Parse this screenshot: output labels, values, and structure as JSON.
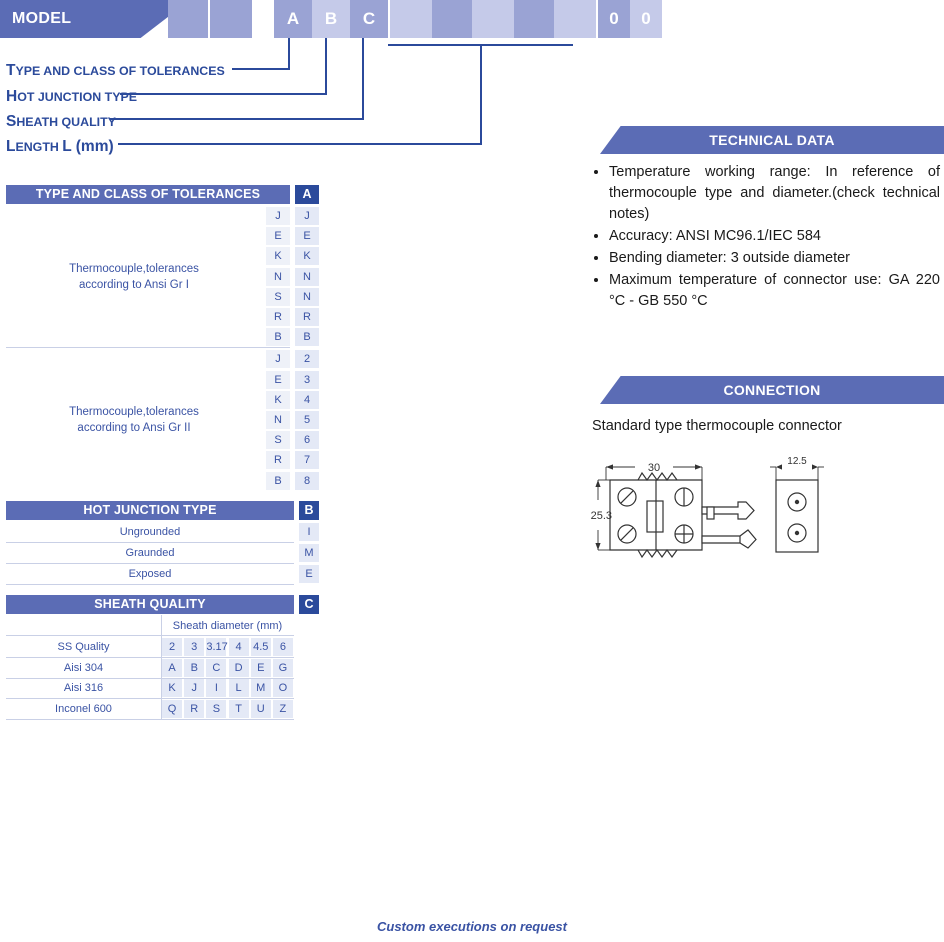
{
  "model": {
    "banner_label": "MODEL",
    "boxes": [
      {
        "label": "",
        "shade": "dark"
      },
      {
        "label": "",
        "shade": "dark"
      },
      {
        "label": "A",
        "shade": "dark"
      },
      {
        "label": "B",
        "shade": "light"
      },
      {
        "label": "C",
        "shade": "dark"
      },
      {
        "label": "",
        "shade": "light"
      },
      {
        "label": "",
        "shade": "dark"
      },
      {
        "label": "",
        "shade": "light"
      },
      {
        "label": "",
        "shade": "dark"
      },
      {
        "label": "",
        "shade": "light"
      },
      {
        "label": "0",
        "shade": "dark"
      },
      {
        "label": "0",
        "shade": "light"
      }
    ],
    "legend": [
      {
        "first": "T",
        "rest": "YPE AND CLASS OF TOLERANCES"
      },
      {
        "first": "H",
        "rest": "OT JUNCTION TYPE"
      },
      {
        "first": "S",
        "rest": "HEATH QUALITY"
      },
      {
        "first": "L",
        "rest": "ENGTH ",
        "suffix": "L (mm)"
      }
    ]
  },
  "tolerance_table": {
    "title": "TYPE AND CLASS OF TOLERANCES",
    "code_header": "A",
    "groups": [
      {
        "description_line1": "Thermocouple,tolerances",
        "description_line2": "according to Ansi Gr I",
        "types": [
          "J",
          "E",
          "K",
          "N",
          "S",
          "R",
          "B"
        ],
        "codes": [
          "J",
          "E",
          "K",
          "N",
          "N",
          "R",
          "B"
        ]
      },
      {
        "description_line1": "Thermocouple,tolerances",
        "description_line2": "according to Ansi Gr II",
        "types": [
          "J",
          "E",
          "K",
          "N",
          "S",
          "R",
          "B"
        ],
        "codes": [
          "2",
          "3",
          "4",
          "5",
          "6",
          "7",
          "8"
        ]
      }
    ]
  },
  "junction_table": {
    "title": "HOT JUNCTION TYPE",
    "code_header": "B",
    "rows": [
      {
        "label": "Ungrounded",
        "code": "I"
      },
      {
        "label": "Graunded",
        "code": "M"
      },
      {
        "label": "Exposed",
        "code": "E"
      }
    ]
  },
  "sheath_table": {
    "title": "SHEATH QUALITY",
    "code_header": "C",
    "diameter_header": "Sheath diameter (mm)",
    "rows": [
      {
        "label": "SS Quality",
        "cells": [
          "2",
          "3",
          "3.17",
          "4",
          "4.5",
          "6"
        ]
      },
      {
        "label": "Aisi 304",
        "cells": [
          "A",
          "B",
          "C",
          "D",
          "E",
          "G"
        ]
      },
      {
        "label": "Aisi 316",
        "cells": [
          "K",
          "J",
          "I",
          "L",
          "M",
          "O"
        ]
      },
      {
        "label": "Inconel 600",
        "cells": [
          "Q",
          "R",
          "S",
          "T",
          "U",
          "Z"
        ]
      }
    ]
  },
  "technical_data": {
    "title": "TECHNICAL DATA",
    "bullets": [
      "Temperature working range: In reference of thermocouple type and diameter.(check technical notes)",
      "Accuracy: ANSI MC96.1/IEC 584",
      "Bending diameter: 3  outside diameter",
      "Maximum temperature of connector use: GA 220 °C - GB 550 °C"
    ]
  },
  "connection": {
    "title": "CONNECTION",
    "subtitle": "Standard type thermocouple connector",
    "drawing": {
      "width_dim": "30",
      "height_dim": "25.3",
      "end_dim": "12.5"
    }
  },
  "footer": {
    "note": "Custom executions on request"
  },
  "colors": {
    "banner": "#5b6cb5",
    "code_badge": "#2b4a9b",
    "box_dark": "#9aa3d4",
    "box_light": "#c5cae9",
    "text_blue": "#3a53a4"
  }
}
